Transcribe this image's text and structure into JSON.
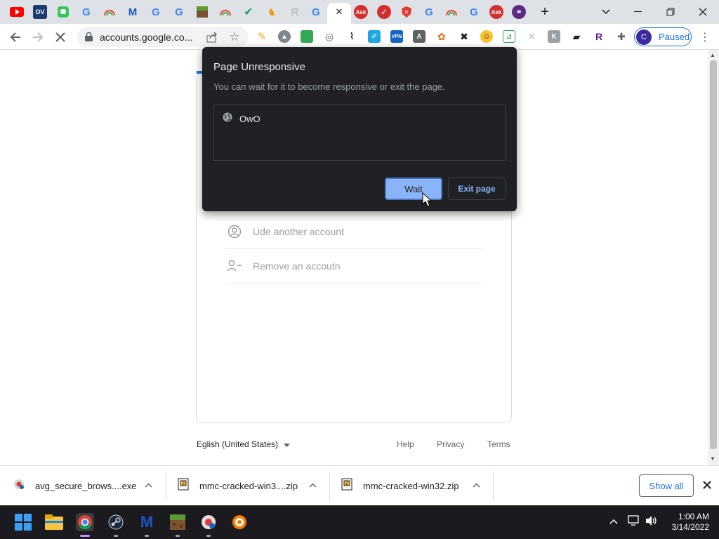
{
  "browser": {
    "tabs": [
      {
        "icon": "youtube-icon"
      },
      {
        "icon": "ov-icon"
      },
      {
        "icon": "chat-icon"
      },
      {
        "icon": "google-icon"
      },
      {
        "icon": "rainbow-icon"
      },
      {
        "icon": "malwarebytes-icon"
      },
      {
        "icon": "google-icon"
      },
      {
        "icon": "google-icon"
      },
      {
        "icon": "minecraft-block-icon"
      },
      {
        "icon": "rainbow-icon"
      },
      {
        "icon": "checkmark-icon"
      },
      {
        "icon": "figure-icon"
      },
      {
        "icon": "r-letter-icon"
      },
      {
        "icon": "google-icon"
      },
      {
        "icon": "close-icon"
      },
      {
        "icon": "ask-icon"
      },
      {
        "icon": "red-check-icon"
      },
      {
        "icon": "shield-icon"
      },
      {
        "icon": "google-icon"
      },
      {
        "icon": "rainbow-icon"
      },
      {
        "icon": "google-icon"
      },
      {
        "icon": "ask-icon"
      },
      {
        "icon": "link-icon"
      }
    ],
    "new_tab_glyph": "+",
    "address": "accounts.google.co...",
    "profile": {
      "initial": "C",
      "status": "Paused"
    }
  },
  "page": {
    "rows": [
      {
        "label": "Ude another account",
        "icon": "account-circle-icon"
      },
      {
        "label": "Remove an accoutn",
        "icon": "person-remove-icon"
      }
    ],
    "footer": {
      "language": "Eglish (United States)",
      "help": "Help",
      "privacy": "Privacy",
      "terms": "Terms"
    }
  },
  "dialog": {
    "title": "Page Unresponsive",
    "message": "You can wait for it to become responsive or exit the page.",
    "page_item": "OwO",
    "wait_label": "Wait",
    "exit_label": "Exit page"
  },
  "downloads": {
    "items": [
      {
        "name": "avg_secure_brows....exe"
      },
      {
        "name": "mmc-cracked-win3....zip"
      },
      {
        "name": "mmc-cracked-win32.zip"
      }
    ],
    "show_all": "Show all"
  },
  "taskbar": {
    "time": "1:00 AM",
    "date": "3/14/2022"
  },
  "colors": {
    "accent": "#1a73e8",
    "dialog_bg": "#202124",
    "wait_button": "#8ab4f8"
  }
}
